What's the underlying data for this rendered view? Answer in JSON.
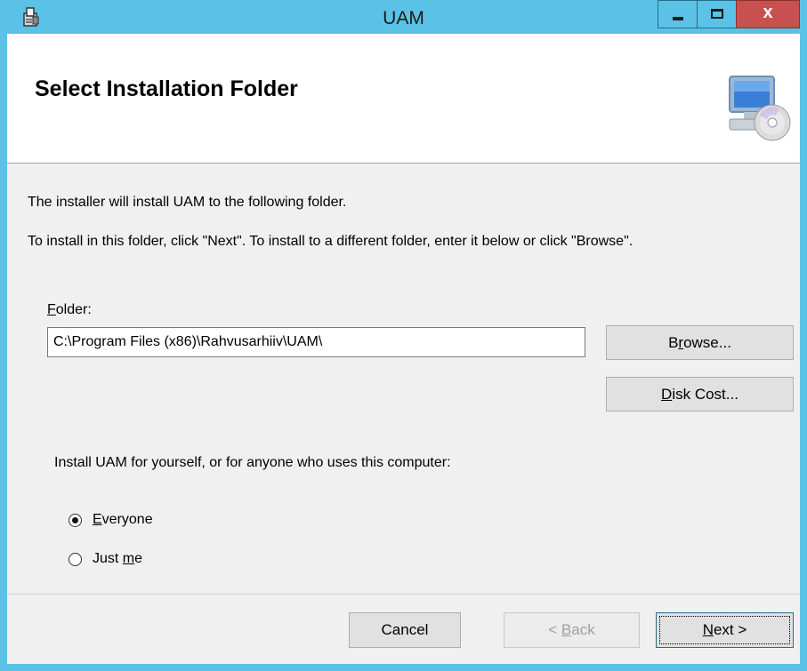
{
  "window": {
    "title": "UAM",
    "close_label": "x"
  },
  "banner": {
    "title": "Select Installation Folder"
  },
  "intro": {
    "line1": "The installer will install UAM to the following folder.",
    "line2": "To install in this folder, click \"Next\". To install to a different folder, enter it below or click \"Browse\"."
  },
  "folder": {
    "label_accel": "F",
    "label_rest": "older:",
    "value": "C:\\Program Files (x86)\\Rahvusarhiiv\\UAM\\"
  },
  "buttons": {
    "browse_pre": "B",
    "browse_accel": "r",
    "browse_rest": "owse...",
    "disk_accel": "D",
    "disk_rest": "isk Cost...",
    "cancel": "Cancel",
    "back_pre": "< ",
    "back_accel": "B",
    "back_rest": "ack",
    "next_accel": "N",
    "next_rest": "ext >"
  },
  "scope": {
    "question": "Install UAM for yourself, or for anyone who uses this computer:",
    "everyone_accel": "E",
    "everyone_rest": "veryone",
    "everyone_selected": true,
    "justme_pre": "Just ",
    "justme_accel": "m",
    "justme_rest": "e",
    "justme_selected": false
  },
  "colors": {
    "titlebar": "#5bc2e7",
    "close": "#c75050"
  }
}
